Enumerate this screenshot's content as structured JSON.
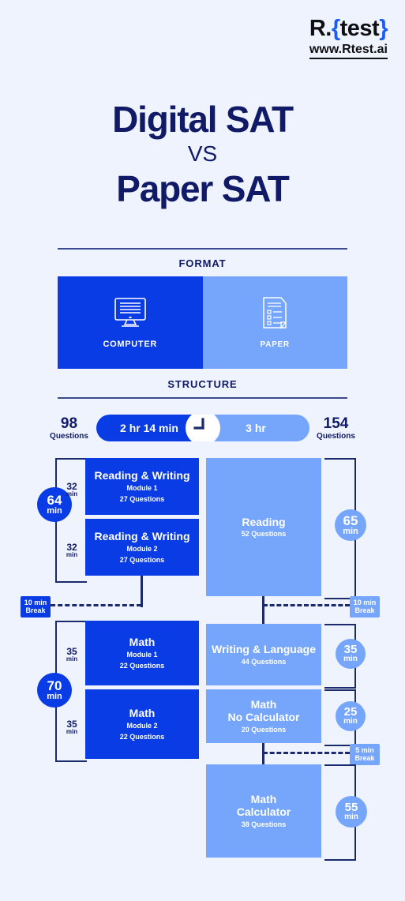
{
  "logo": {
    "name_left": "R.",
    "brace_open": "{",
    "name_right": "test",
    "brace_close": "}",
    "url": "www.Rtest.ai"
  },
  "title": {
    "line1": "Digital SAT",
    "vs": "VS",
    "line2": "Paper SAT"
  },
  "sections": {
    "format": "FORMAT",
    "structure": "STRUCTURE"
  },
  "format": {
    "digital": {
      "icon": "monitor-icon",
      "caption": "COMPUTER"
    },
    "paper": {
      "icon": "document-icon",
      "caption": "PAPER"
    }
  },
  "timeline": {
    "left_questions_num": "98",
    "left_questions_label": "Questions",
    "digital_duration": "2 hr 14 min",
    "paper_duration": "3 hr",
    "right_questions_num": "154",
    "right_questions_label": "Questions",
    "clock_icon": "clock-icon"
  },
  "digital": {
    "group1": {
      "total_num": "64",
      "total_unit": "min",
      "blocks": [
        {
          "min_num": "32",
          "min_unit": "min",
          "title": "Reading & Writing",
          "sub": "Module 1",
          "questions": "27 Questions"
        },
        {
          "min_num": "32",
          "min_unit": "min",
          "title": "Reading & Writing",
          "sub": "Module 2",
          "questions": "27 Questions"
        }
      ]
    },
    "break": {
      "line1": "10 min",
      "line2": "Break"
    },
    "group2": {
      "total_num": "70",
      "total_unit": "min",
      "blocks": [
        {
          "min_num": "35",
          "min_unit": "min",
          "title": "Math",
          "sub": "Module 1",
          "questions": "22 Questions"
        },
        {
          "min_num": "35",
          "min_unit": "min",
          "title": "Math",
          "sub": "Module 2",
          "questions": "22 Questions"
        }
      ]
    }
  },
  "paper": {
    "blocks": [
      {
        "title": "Reading",
        "title2": "",
        "questions": "52 Questions",
        "min_num": "65",
        "min_unit": "min"
      },
      {
        "title": "Writing & Language",
        "title2": "",
        "questions": "44 Questions",
        "min_num": "35",
        "min_unit": "min"
      },
      {
        "title": "Math",
        "title2": "No Calculator",
        "questions": "20 Questions",
        "min_num": "25",
        "min_unit": "min"
      },
      {
        "title": "Math",
        "title2": "Calculator",
        "questions": "38 Questions",
        "min_num": "55",
        "min_unit": "min"
      }
    ],
    "break1": {
      "line1": "10 min",
      "line2": "Break"
    },
    "break2": {
      "line1": "5 min",
      "line2": "Break"
    }
  },
  "colors": {
    "background": "#eef3fd",
    "navy": "#111a66",
    "dark_blue": "#0a3ce6",
    "light_blue": "#76a6fb",
    "outline": "#1b2a6b",
    "white": "#ffffff"
  }
}
